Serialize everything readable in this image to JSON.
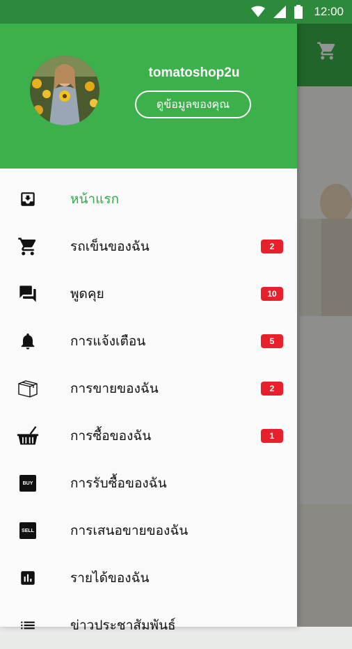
{
  "status_bar": {
    "time": "12:00"
  },
  "drawer": {
    "username": "tomatoshop2u",
    "profile_button": "ดูข้อมูลของคุณ",
    "menu": [
      {
        "label": "หน้าแรก",
        "icon": "home-download-icon",
        "active": true,
        "badge": null
      },
      {
        "label": "รถเข็นของฉัน",
        "icon": "cart-icon",
        "active": false,
        "badge": "2"
      },
      {
        "label": "พูดคุย",
        "icon": "chat-icon",
        "active": false,
        "badge": "10"
      },
      {
        "label": "การแจ้งเตือน",
        "icon": "bell-icon",
        "active": false,
        "badge": "5"
      },
      {
        "label": "การขายของฉัน",
        "icon": "box-icon",
        "active": false,
        "badge": "2"
      },
      {
        "label": "การซื้อของฉัน",
        "icon": "basket-icon",
        "active": false,
        "badge": "1"
      },
      {
        "label": "การรับซื้อของฉัน",
        "icon": "buy-tag-icon",
        "tag_text": "BUY",
        "active": false,
        "badge": null
      },
      {
        "label": "การเสนอขายของฉัน",
        "icon": "sell-tag-icon",
        "tag_text": "SELL",
        "active": false,
        "badge": null
      },
      {
        "label": "รายได้ของฉัน",
        "icon": "bar-chart-icon",
        "active": false,
        "badge": null
      },
      {
        "label": "ข่าวประชาสัมพันธ์",
        "icon": "list-icon",
        "active": false,
        "badge": null
      }
    ]
  },
  "colors": {
    "accent": "#3cb04b",
    "status_bar": "#2c8a3a",
    "active_text": "#2fa94a",
    "badge": "#e8202c"
  }
}
